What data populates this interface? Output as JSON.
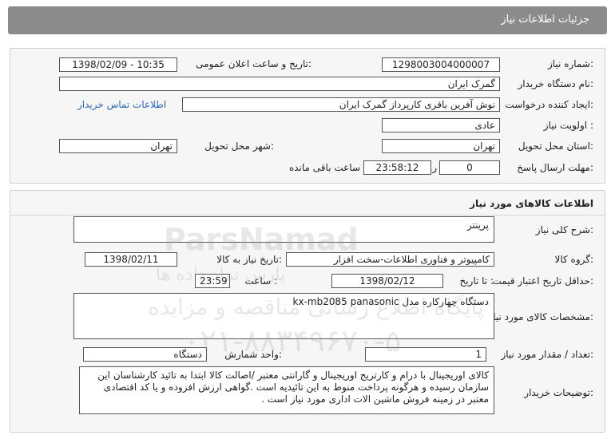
{
  "header": {
    "title": "جزئیات اطلاعات نیاز"
  },
  "info": {
    "need_number_label": "شماره نیاز:",
    "need_number": "1298003004000007",
    "announce_label": "تاریخ و ساعت اعلان عمومی:",
    "announce_value": "1398/02/09 - 10:35",
    "buyer_org_label": "نام دستگاه خریدار:",
    "buyer_org": "گمرک ایران",
    "creator_label": "ایجاد کننده درخواست:",
    "creator": "نوش آفرین باقری کارپرداز گمرک ایران",
    "contact_link": "اطلاعات تماس خریدار",
    "priority_label": "اولویت نیاز :",
    "priority": "عادی",
    "province_label": "استان محل تحویل:",
    "province": "تهران",
    "city_label": "شهر محل تحویل:",
    "city": "تهران",
    "deadline_label": "مهلت ارسال پاسخ:",
    "deadline_days": "0",
    "days_word": "روز و",
    "deadline_time": "23:58:12",
    "remaining_word": "ساعت باقی مانده"
  },
  "goods": {
    "section_title": "اطلاعات کالاهای مورد نیاز",
    "general_desc_label": "شرح کلی نیاز:",
    "general_desc": "پرینتر",
    "group_label": "گروه کالا:",
    "group": "کامپیوتر و فناوری اطلاعات-سخت افزار",
    "need_date_label": "تاریخ نیاز به کالا:",
    "need_date": "1398/02/11",
    "min_validity_label": "حداقل تاریخ اعتبار قیمت:",
    "until_date_label": "تا تاریخ :",
    "until_date": "1398/02/12",
    "time_label": "ساعت :",
    "time": "23:59",
    "spec_label": "مشخصات کالای مورد نیاز:",
    "spec": "دستگاه چهارکاره مدل kx-mb2085 panasonic",
    "qty_label": "تعداد / مقدار مورد نیاز:",
    "qty": "1",
    "unit_label": "واحد شمارش:",
    "unit": "دستگاه",
    "buyer_notes_label": "توضیحات خریدار:",
    "buyer_notes": "کالای اوریجینال با درام و کارتریج اوریجینال و گارانتی معتبر /اصالت کالا ابتدا به تائید کارشناسان این سازمان رسیده و هرگونه پرداخت منوط به این تائیدیه است .گواهی ارزش افزوده و یا کد اقتصادی معتبر در زمینه فروش ماشین الات اداری مورد نیاز است ."
  },
  "watermark": {
    "brand": "ParsNamad",
    "tagline": "پایگاه اطلاع رسانی مناقصه و مزایده",
    "phone": "۰۲۱-۸۸۳۴۹۶۷۰-۵",
    "site": "پارس نماد داده ها"
  }
}
